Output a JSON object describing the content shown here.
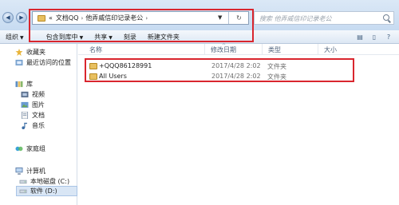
{
  "address": {
    "prefix": "«",
    "crumbs": [
      "文档QQ",
      "他弄威信印记录老公"
    ],
    "separator": "›"
  },
  "search": {
    "placeholder": "搜索 他弄威信印记录老公"
  },
  "toolbar": {
    "organize": "组织",
    "include_in_library": "包含到库中",
    "share": "共享",
    "burn": "刻录",
    "new_folder": "新建文件夹"
  },
  "navpane": {
    "items": [
      {
        "label": "收藏夹",
        "icon": "star-icon"
      },
      {
        "label": "最近访问的位置",
        "icon": "recent-places-icon"
      },
      {
        "label": "库",
        "icon": "library-icon"
      },
      {
        "label": "视频",
        "icon": "video-icon"
      },
      {
        "label": "图片",
        "icon": "picture-icon"
      },
      {
        "label": "文档",
        "icon": "document-icon"
      },
      {
        "label": "音乐",
        "icon": "music-icon"
      },
      {
        "label": "家庭组",
        "icon": "homegroup-icon"
      },
      {
        "label": "计算机",
        "icon": "computer-icon"
      },
      {
        "label": "本地磁盘 (C:)",
        "icon": "drive-icon"
      },
      {
        "label": "软件 (D:)",
        "icon": "drive-icon"
      }
    ]
  },
  "columns": {
    "name": "名称",
    "date": "修改日期",
    "type": "类型",
    "size": "大小"
  },
  "files": [
    {
      "name": "+QQQ86128991",
      "date": "2017/4/28 2:02",
      "type": "文件夹"
    },
    {
      "name": "All Users",
      "date": "2017/4/28 2:02",
      "type": "文件夹"
    }
  ],
  "colors": {
    "highlight": "#d9262e",
    "folder": "#e8c060",
    "accent": "#d9e6f5"
  }
}
